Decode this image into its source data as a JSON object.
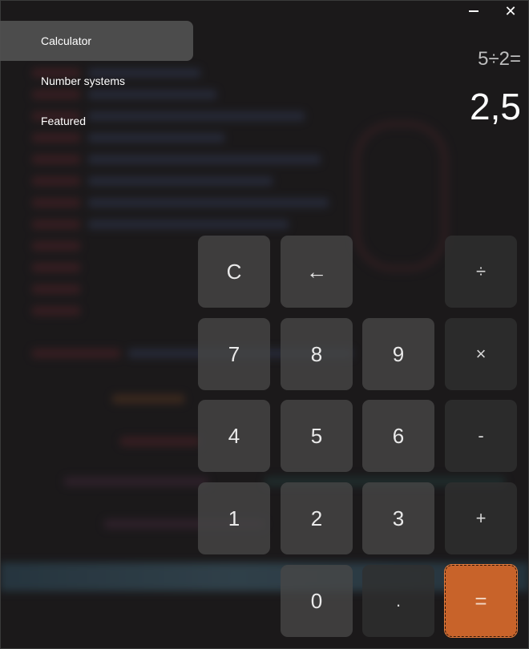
{
  "window": {
    "minimize_icon": "minimize-icon",
    "close_icon": "close-icon",
    "close_glyph": "✕"
  },
  "sidebar": {
    "items": [
      {
        "label": "Calculator",
        "active": true
      },
      {
        "label": "Number systems",
        "active": false
      },
      {
        "label": "Featured",
        "active": false
      }
    ]
  },
  "display": {
    "expression": "5÷2=",
    "result": "2,5"
  },
  "keypad": {
    "clear": "C",
    "backspace": "←",
    "divide": "÷",
    "multiply": "×",
    "minus": "-",
    "plus": "+",
    "equals": "=",
    "decimal": ".",
    "digits": {
      "0": "0",
      "1": "1",
      "2": "2",
      "3": "3",
      "4": "4",
      "5": "5",
      "6": "6",
      "7": "7",
      "8": "8",
      "9": "9"
    }
  },
  "colors": {
    "accent": "#c8632a",
    "active_nav": "#505050",
    "key": "#484848"
  }
}
